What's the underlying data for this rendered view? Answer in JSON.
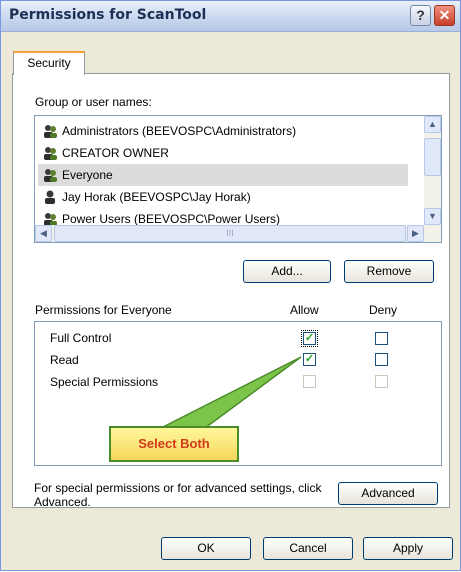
{
  "window": {
    "title": "Permissions for ScanTool",
    "help_label": "?",
    "close_label": "✕"
  },
  "tab": {
    "label": "Security"
  },
  "groups": {
    "label": "Group or user names:",
    "items": [
      {
        "name": "Administrators (BEEVOSPC\\Administrators)",
        "icon": "group-icon"
      },
      {
        "name": "CREATOR OWNER",
        "icon": "group-icon"
      },
      {
        "name": "Everyone",
        "icon": "group-icon",
        "selected": true
      },
      {
        "name": "Jay Horak (BEEVOSPC\\Jay Horak)",
        "icon": "user-icon"
      },
      {
        "name": "Power Users (BEEVOSPC\\Power Users)",
        "icon": "group-icon"
      }
    ],
    "scroll_up": "▲",
    "scroll_down": "▼",
    "scroll_left": "◀",
    "scroll_right": "▶",
    "thumb_grip": "III"
  },
  "buttons": {
    "add": "Add...",
    "remove": "Remove",
    "advanced": "Advanced",
    "ok": "OK",
    "cancel": "Cancel",
    "apply": "Apply"
  },
  "permissions": {
    "label": "Permissions for Everyone",
    "allow_header": "Allow",
    "deny_header": "Deny",
    "rows": [
      {
        "name": "Full Control",
        "allow": true,
        "deny": false,
        "disabled": false
      },
      {
        "name": "Read",
        "allow": true,
        "deny": false,
        "disabled": false
      },
      {
        "name": "Special Permissions",
        "allow": false,
        "deny": false,
        "disabled": true
      }
    ],
    "check_glyph": "✓"
  },
  "advanced_text": "For special permissions or for advanced settings, click Advanced.",
  "callout": {
    "text": "Select Both"
  }
}
